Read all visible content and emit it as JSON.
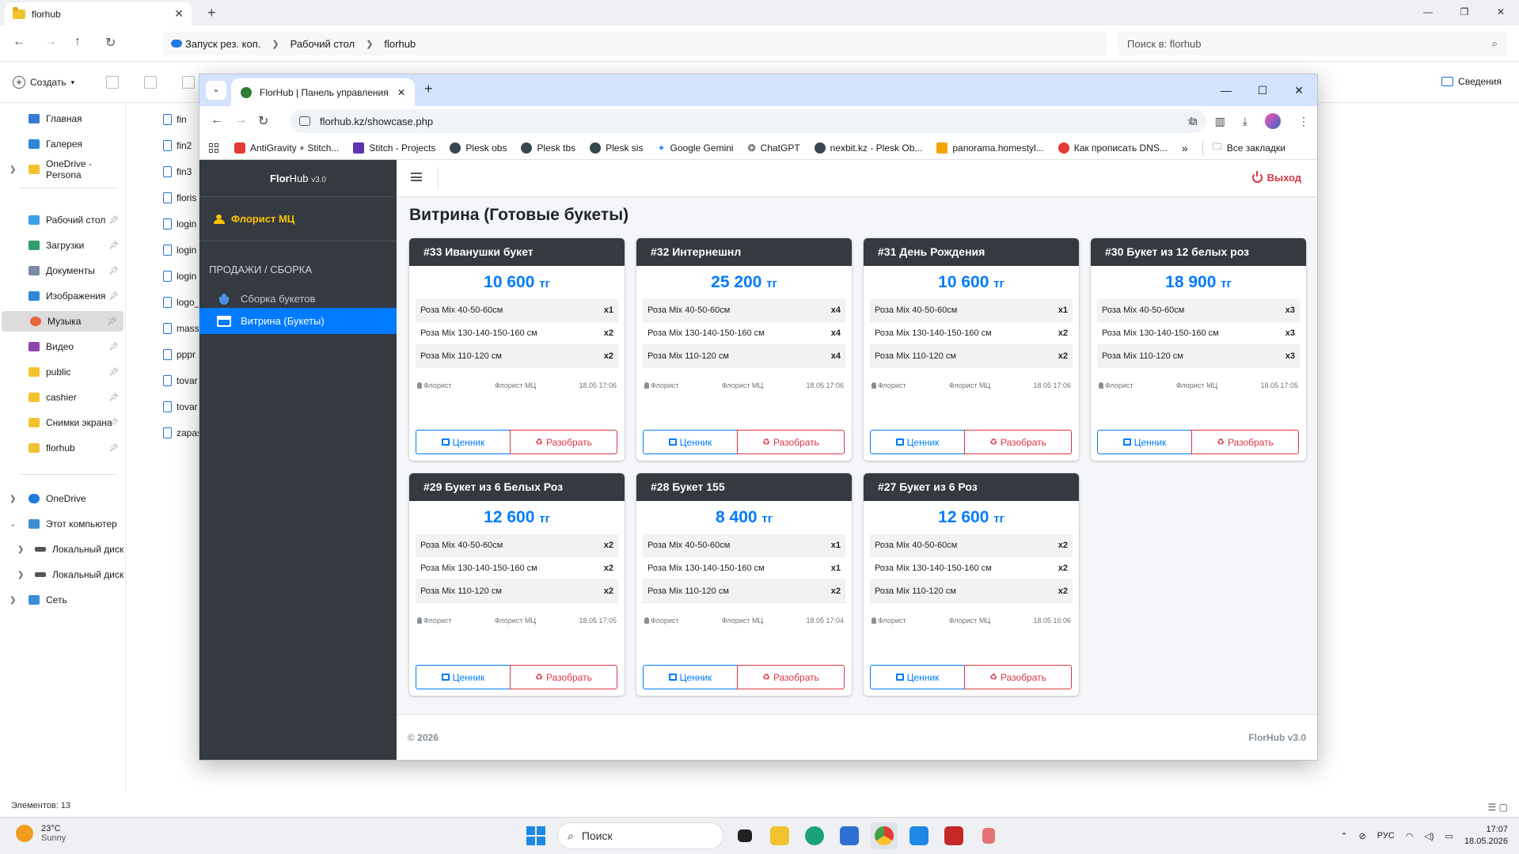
{
  "explorer": {
    "tab_title": "florhub",
    "path": [
      "Запуск рез. коп.",
      "Рабочий стол",
      "florhub"
    ],
    "search_placeholder": "Поиск в: florhub",
    "create_label": "Создать",
    "details_label": "Сведения",
    "status": "Элементов: 13",
    "sidebar": [
      {
        "label": "Главная",
        "color": "#3a7bd5"
      },
      {
        "label": "Галерея",
        "color": "#2b88d8"
      },
      {
        "label": "OneDrive - Persona",
        "color": "#f2c12e"
      },
      {
        "label": "Рабочий стол",
        "color": "#3aa0e8"
      },
      {
        "label": "Загрузки",
        "color": "#2e9e6f"
      },
      {
        "label": "Документы",
        "color": "#7a8aa8"
      },
      {
        "label": "Изображения",
        "color": "#2f86d6"
      },
      {
        "label": "Музыка",
        "color": "#e8643a"
      },
      {
        "label": "Видео",
        "color": "#8e44ad"
      },
      {
        "label": "public",
        "color": "#f2c12e"
      },
      {
        "label": "cashier",
        "color": "#f2c12e"
      },
      {
        "label": "Снимки экрана",
        "color": "#f2c12e"
      },
      {
        "label": "florhub",
        "color": "#f2c12e"
      },
      {
        "label": "OneDrive",
        "color": "#1f7be0"
      },
      {
        "label": "Этот компьютер",
        "color": "#3a8fd5"
      },
      {
        "label": "Локальный диск",
        "color": "#555555"
      },
      {
        "label": "Локальный диск",
        "color": "#555555"
      },
      {
        "label": "Сеть",
        "color": "#3a8fd5"
      }
    ],
    "files": [
      "fin",
      "fin2",
      "fin3",
      "floris",
      "login",
      "login",
      "login",
      "logo_",
      "mass",
      "pppr",
      "tovar",
      "tovar",
      "zapas"
    ]
  },
  "browser": {
    "tab_title": "FlorHub | Панель управления",
    "url": "florhub.kz/showcase.php",
    "bookmarks": [
      {
        "label": "AntiGravity + Stitch...",
        "color": "#e53935"
      },
      {
        "label": "Stitch - Projects",
        "color": "#5e35b1"
      },
      {
        "label": "Plesk obs",
        "color": "#37474f"
      },
      {
        "label": "Plesk tbs",
        "color": "#37474f"
      },
      {
        "label": "Plesk sis",
        "color": "#37474f"
      },
      {
        "label": "Google Gemini",
        "color": "#4285f4"
      },
      {
        "label": "ChatGPT",
        "color": "#444444"
      },
      {
        "label": "nexbit.kz - Plesk Ob...",
        "color": "#37474f"
      },
      {
        "label": "panorama.homestyl...",
        "color": "#f4a300"
      },
      {
        "label": "Как прописать DNS...",
        "color": "#e53935"
      }
    ],
    "all_bookmarks": "Все закладки"
  },
  "app": {
    "brand_bold": "Flor",
    "brand_rest": "Hub",
    "brand_version": "v3.0",
    "user": "Флорист МЦ",
    "nav_header": "ПРОДАЖИ / СБОРКА",
    "nav": [
      {
        "label": "Сборка букетов"
      },
      {
        "label": "Витрина (Букеты)"
      }
    ],
    "logout": "Выход",
    "page_title": "Витрина (Готовые букеты)",
    "currency": "тг",
    "btn_tag": "Ценник",
    "btn_break": "Разобрать",
    "footer_left": "© 2026",
    "footer_right": "FlorHub v3.0",
    "cards": [
      {
        "title": "#33 Иванушки букет",
        "price": "10 600",
        "items": [
          [
            "Роза Mix 40-50-60см",
            "x1"
          ],
          [
            "Роза Mix 130-140-150-160 см",
            "x2"
          ],
          [
            "Роза Mix 110-120 см",
            "x2"
          ]
        ],
        "role": "Флорист",
        "author": "Флорист МЦ",
        "date": "18.05 17:06"
      },
      {
        "title": "#32 Интернешнл",
        "price": "25 200",
        "items": [
          [
            "Роза Mix 40-50-60см",
            "x4"
          ],
          [
            "Роза Mix 130-140-150-160 см",
            "x4"
          ],
          [
            "Роза Mix 110-120 см",
            "x4"
          ]
        ],
        "role": "Флорист",
        "author": "Флорист МЦ",
        "date": "18.05 17:06"
      },
      {
        "title": "#31 День Рождения",
        "price": "10 600",
        "items": [
          [
            "Роза Mix 40-50-60см",
            "x1"
          ],
          [
            "Роза Mix 130-140-150-160 см",
            "x2"
          ],
          [
            "Роза Mix 110-120 см",
            "x2"
          ]
        ],
        "role": "Флорист",
        "author": "Флорист МЦ",
        "date": "18.05 17:06"
      },
      {
        "title": "#30 Букет из 12 белых роз",
        "price": "18 900",
        "items": [
          [
            "Роза Mix 40-50-60см",
            "x3"
          ],
          [
            "Роза Mix 130-140-150-160 см",
            "x3"
          ],
          [
            "Роза Mix 110-120 см",
            "x3"
          ]
        ],
        "role": "Флорист",
        "author": "Флорист МЦ",
        "date": "18.05 17:05"
      },
      {
        "title": "#29 Букет из 6 Белых Роз",
        "price": "12 600",
        "items": [
          [
            "Роза Mix 40-50-60см",
            "x2"
          ],
          [
            "Роза Mix 130-140-150-160 см",
            "x2"
          ],
          [
            "Роза Mix 110-120 см",
            "x2"
          ]
        ],
        "role": "Флорист",
        "author": "Флорист МЦ",
        "date": "18.05 17:05"
      },
      {
        "title": "#28 Букет 155",
        "price": "8 400",
        "items": [
          [
            "Роза Mix 40-50-60см",
            "x1"
          ],
          [
            "Роза Mix 130-140-150-160 см",
            "x1"
          ],
          [
            "Роза Mix 110-120 см",
            "x2"
          ]
        ],
        "role": "Флорист",
        "author": "Флорист МЦ",
        "date": "18.05 17:04"
      },
      {
        "title": "#27 Букет из 6 Роз",
        "price": "12 600",
        "items": [
          [
            "Роза Mix 40-50-60см",
            "x2"
          ],
          [
            "Роза Mix 130-140-150-160 см",
            "x2"
          ],
          [
            "Роза Mix 110-120 см",
            "x2"
          ]
        ],
        "role": "Флорист",
        "author": "Флорист МЦ",
        "date": "18.05 16:06"
      }
    ]
  },
  "taskbar": {
    "temp": "23°C",
    "weather": "Sunny",
    "search": "Поиск",
    "lang": "РУС",
    "time": "17:07",
    "date": "18.05.2026"
  }
}
